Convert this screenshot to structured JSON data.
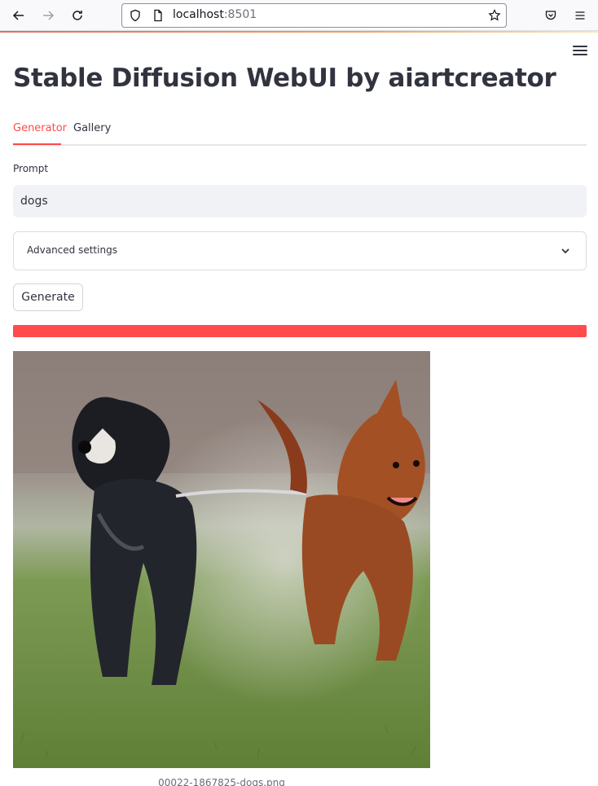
{
  "browser": {
    "url_host": "localhost",
    "url_port": ":8501"
  },
  "app": {
    "title": "Stable Diffusion WebUI by aiartcreator",
    "tabs": [
      {
        "label": "Generator",
        "active": true
      },
      {
        "label": "Gallery",
        "active": false
      }
    ],
    "prompt": {
      "label": "Prompt",
      "value": "dogs"
    },
    "advanced_settings_label": "Advanced settings",
    "generate_label": "Generate",
    "progress_fraction": 1.0,
    "image_caption": "00022-1867825-dogs.png",
    "accent_color": "#ff4b4b"
  }
}
